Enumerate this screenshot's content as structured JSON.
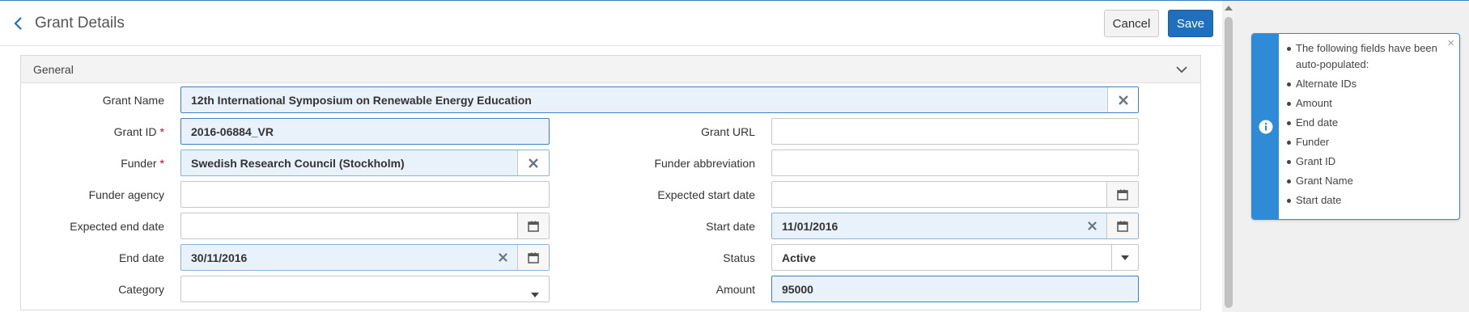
{
  "header": {
    "title": "Grant Details",
    "cancel_label": "Cancel",
    "save_label": "Save"
  },
  "section": {
    "title": "General"
  },
  "fields": {
    "grant_name": {
      "label": "Grant Name",
      "value": "12th International Symposium on Renewable Energy Education"
    },
    "grant_id": {
      "label": "Grant ID",
      "required": "*",
      "value": "2016-06884_VR"
    },
    "funder": {
      "label": "Funder",
      "required": "*",
      "value": "Swedish Research Council (Stockholm)"
    },
    "funder_agency": {
      "label": "Funder agency",
      "value": ""
    },
    "expected_end_date": {
      "label": "Expected end date",
      "value": ""
    },
    "end_date": {
      "label": "End date",
      "value": "30/11/2016"
    },
    "category": {
      "label": "Category",
      "value": ""
    },
    "grant_url": {
      "label": "Grant URL",
      "value": ""
    },
    "funder_abbreviation": {
      "label": "Funder abbreviation",
      "value": ""
    },
    "expected_start_date": {
      "label": "Expected start date",
      "value": ""
    },
    "start_date": {
      "label": "Start date",
      "value": "11/01/2016"
    },
    "status": {
      "label": "Status",
      "value": "Active"
    },
    "amount": {
      "label": "Amount",
      "value": "95000"
    }
  },
  "notification": {
    "close": "×",
    "items": [
      "The following fields have been auto-populated:",
      "Alternate IDs",
      "Amount",
      "End date",
      "Funder",
      "Grant ID",
      "Grant Name",
      "Start date"
    ]
  },
  "colors": {
    "accent": "#1f6fbf",
    "info": "#2f8bd6",
    "required": "#d0021b",
    "filled_field": "#e9f1fb"
  },
  "icons": {
    "back": "chevron-left-icon",
    "collapse": "chevron-down-icon",
    "clear": "x-icon",
    "calendar": "calendar-icon",
    "dropdown": "caret-down-icon",
    "info": "info-icon"
  }
}
